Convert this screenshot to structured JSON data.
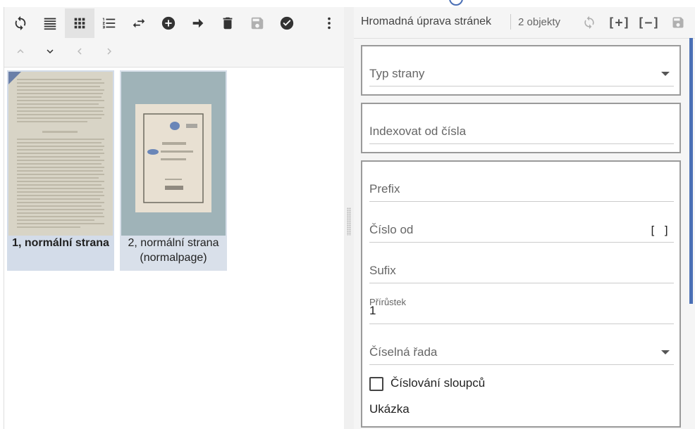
{
  "toolbar": {
    "buttons": [
      {
        "icon": "refresh-icon"
      },
      {
        "icon": "list-view-icon"
      },
      {
        "icon": "grid-view-icon",
        "active": true
      },
      {
        "icon": "numbered-list-icon"
      },
      {
        "icon": "swap-icon"
      },
      {
        "icon": "add-circle-icon"
      },
      {
        "icon": "arrow-right-icon"
      },
      {
        "icon": "trash-icon"
      },
      {
        "icon": "save-icon",
        "disabled": true
      },
      {
        "icon": "check-circle-icon"
      },
      {
        "icon": "more-vert-icon"
      }
    ],
    "nav": [
      "chevron-up-icon",
      "chevron-down-icon",
      "chevron-left-icon",
      "chevron-right-icon"
    ]
  },
  "thumbnails": [
    {
      "caption": "1, normální strana",
      "selected": true
    },
    {
      "caption": "2, normální strana (normalpage)",
      "selected": false
    }
  ],
  "panel": {
    "title": "Hromadná úprava stránek",
    "count": "2 objekty",
    "add_label": "[+]",
    "remove_label": "[−]",
    "page_type_label": "Typ strany",
    "index_from_label": "Indexovat od čísla",
    "prefix_label": "Prefix",
    "number_from_label": "Číslo od",
    "number_from_brackets": "[ ]",
    "suffix_label": "Sufix",
    "increment_label": "Přírůstek",
    "increment_value": "1",
    "number_series_label": "Číselná řada",
    "column_numbering_label": "Číslování sloupců",
    "column_numbering_checked": false,
    "preview_label": "Ukázka"
  },
  "colors": {
    "accent": "#4a6fb5",
    "selected_bg": "#d3dce9"
  }
}
